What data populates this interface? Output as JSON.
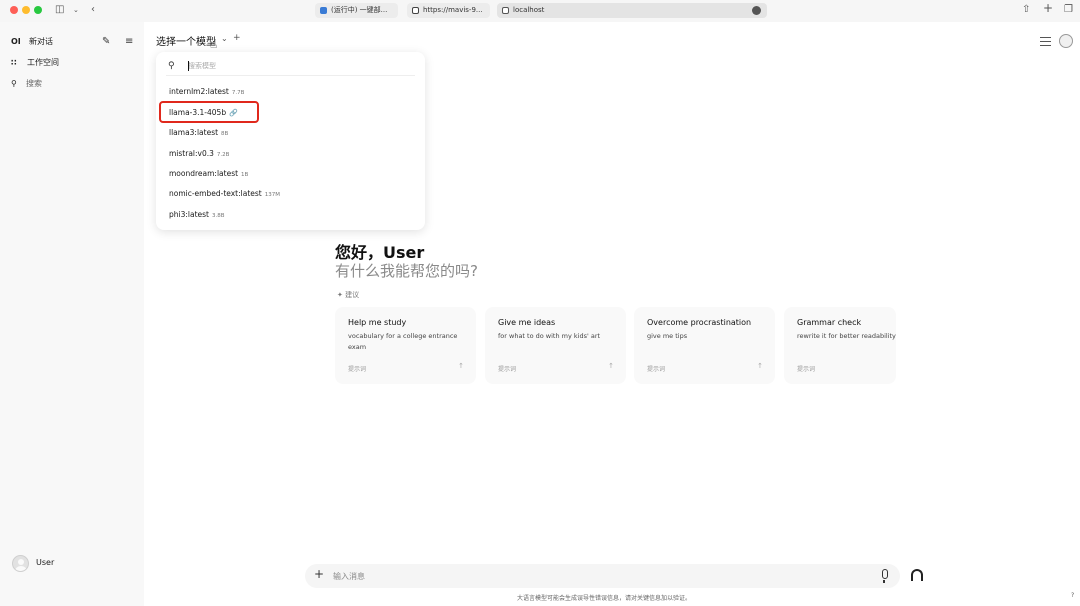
{
  "browser": {
    "tabs": [
      {
        "label": "(运行中) 一键部...",
        "fav": "#3a7bd5"
      },
      {
        "label": "https://mavis-9...",
        "fav": "#444444"
      },
      {
        "label": "localhost",
        "fav": "#555555"
      }
    ],
    "icons": [
      "sidebar-toggle-icon",
      "chevron-down-icon",
      "back-icon",
      "share-icon",
      "new-tab-icon",
      "tabs-overview-icon"
    ]
  },
  "sidebar": {
    "logo": "OI",
    "new_chat": "新对话",
    "workspace": "工作空间",
    "search": "搜索",
    "user_name": "User"
  },
  "header": {
    "model_select_title": "选择一个模型",
    "add_model": "+"
  },
  "dropdown": {
    "search_placeholder": "搜索模型",
    "models": [
      {
        "name": "internlm2:latest",
        "size": "7.7B"
      },
      {
        "name": "llama-3.1-405b",
        "size": "",
        "icon": "link-icon"
      },
      {
        "name": "llama3:latest",
        "size": "8B"
      },
      {
        "name": "mistral:v0.3",
        "size": "7.2B"
      },
      {
        "name": "moondream:latest",
        "size": "1B"
      },
      {
        "name": "nomic-embed-text:latest",
        "size": "137M"
      },
      {
        "name": "phi3:latest",
        "size": "3.8B"
      }
    ],
    "highlight_color": "#e0281c"
  },
  "main": {
    "greeting": "您好，User",
    "subtitle": "有什么我能帮您的吗?",
    "suggest_label": "建议",
    "cards": [
      {
        "title": "Help me study",
        "desc": "vocabulary for a college entrance exam",
        "hint": "提示词"
      },
      {
        "title": "Give me ideas",
        "desc": "for what to do with my kids' art",
        "hint": "提示词"
      },
      {
        "title": "Overcome procrastination",
        "desc": "give me tips",
        "hint": "提示词"
      },
      {
        "title": "Grammar check",
        "desc": "rewrite it for better readability",
        "hint": "提示词"
      }
    ]
  },
  "input": {
    "placeholder": "输入消息",
    "disclaimer": "大语言模型可能会生成误导性错误信息，请对关键信息加以验证。"
  },
  "help": "?"
}
